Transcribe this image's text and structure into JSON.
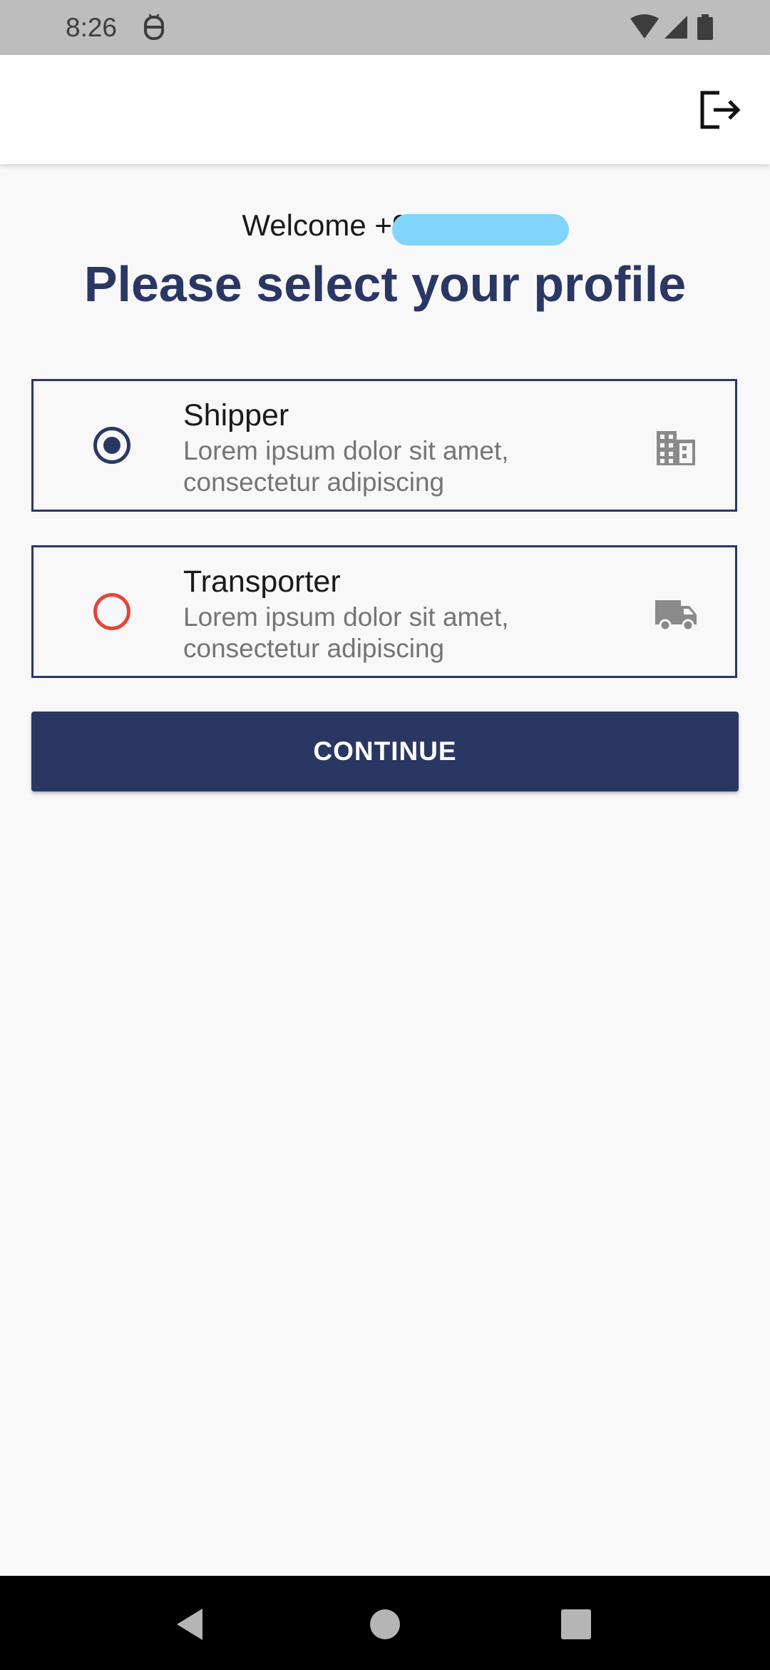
{
  "status_bar": {
    "time": "8:26",
    "icons": [
      "robot-icon",
      "wifi-icon",
      "signal-icon",
      "battery-icon"
    ]
  },
  "app_bar": {
    "logout_icon": "logout-icon"
  },
  "header": {
    "welcome": "Welcome +91-",
    "title": "Please select your profile"
  },
  "options": [
    {
      "title": "Shipper",
      "description": "Lorem ipsum dolor sit amet, consectetur adipiscing",
      "selected": true,
      "icon": "building-icon"
    },
    {
      "title": "Transporter",
      "description": "Lorem ipsum dolor sit amet, consectetur adipiscing",
      "selected": false,
      "icon": "truck-icon"
    }
  ],
  "continue_label": "CONTINUE",
  "colors": {
    "primary": "#2b3763",
    "unselected_radio": "#e2463a",
    "redaction": "#81d4fa",
    "background": "#f8f8f9"
  },
  "nav_bar": {
    "icons": [
      "back-icon",
      "home-icon",
      "recents-icon"
    ]
  }
}
